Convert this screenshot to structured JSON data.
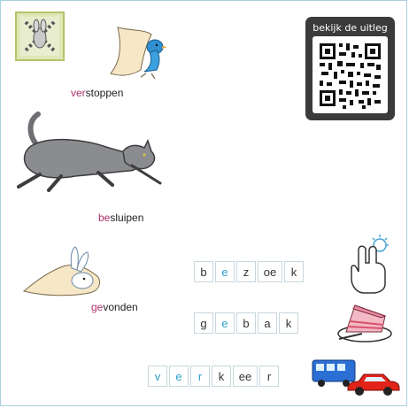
{
  "qr": {
    "title": "bekijk de uitleg"
  },
  "words": [
    {
      "prefix": "ver",
      "rest": "stoppen"
    },
    {
      "prefix": "be",
      "rest": "sluipen"
    },
    {
      "prefix": "ge",
      "rest": "vonden"
    }
  ],
  "rows": [
    {
      "letters": [
        "b",
        "e",
        "z",
        "oe",
        "k"
      ],
      "vowels": [
        false,
        true,
        false,
        false,
        false
      ]
    },
    {
      "letters": [
        "g",
        "e",
        "b",
        "a",
        "k"
      ],
      "vowels": [
        false,
        true,
        false,
        false,
        false
      ]
    },
    {
      "letters": [
        "v",
        "e",
        "r",
        "k",
        "ee",
        "r"
      ],
      "vowels": [
        true,
        true,
        true,
        false,
        false,
        false
      ]
    }
  ],
  "colors": {
    "prefix": "#b0306a",
    "vowel": "#2c9fc9",
    "border": "#a9cfe0"
  },
  "icons": [
    "logo-icon",
    "bird-under-cloth-icon",
    "cat-sneaking-icon",
    "rabbit-under-cloth-icon",
    "tap-hand-icon",
    "cake-icon",
    "bus-icon",
    "car-icon"
  ]
}
